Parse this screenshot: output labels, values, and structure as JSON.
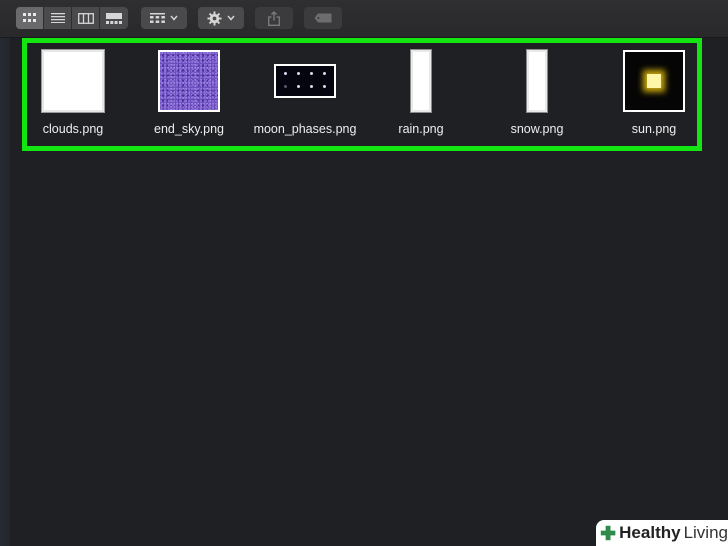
{
  "toolbar": {
    "view_buttons": [
      {
        "icon": "icon-view-icon",
        "active": true
      },
      {
        "icon": "list-view-icon",
        "active": false
      },
      {
        "icon": "column-view-icon",
        "active": false
      },
      {
        "icon": "gallery-view-icon",
        "active": false
      }
    ],
    "group_button_icon": "group-by-grid-icon",
    "action_button_icon": "gear-icon",
    "share_button_icon": "share-icon",
    "tag_button_icon": "tag-icon"
  },
  "files": [
    {
      "name": "clouds.png"
    },
    {
      "name": "end_sky.png"
    },
    {
      "name": "moon_phases.png"
    },
    {
      "name": "rain.png"
    },
    {
      "name": "snow.png"
    },
    {
      "name": "sun.png"
    }
  ],
  "selection_color": "#13e513",
  "watermark": {
    "brand": "Healthy",
    "brand2": "Living"
  }
}
